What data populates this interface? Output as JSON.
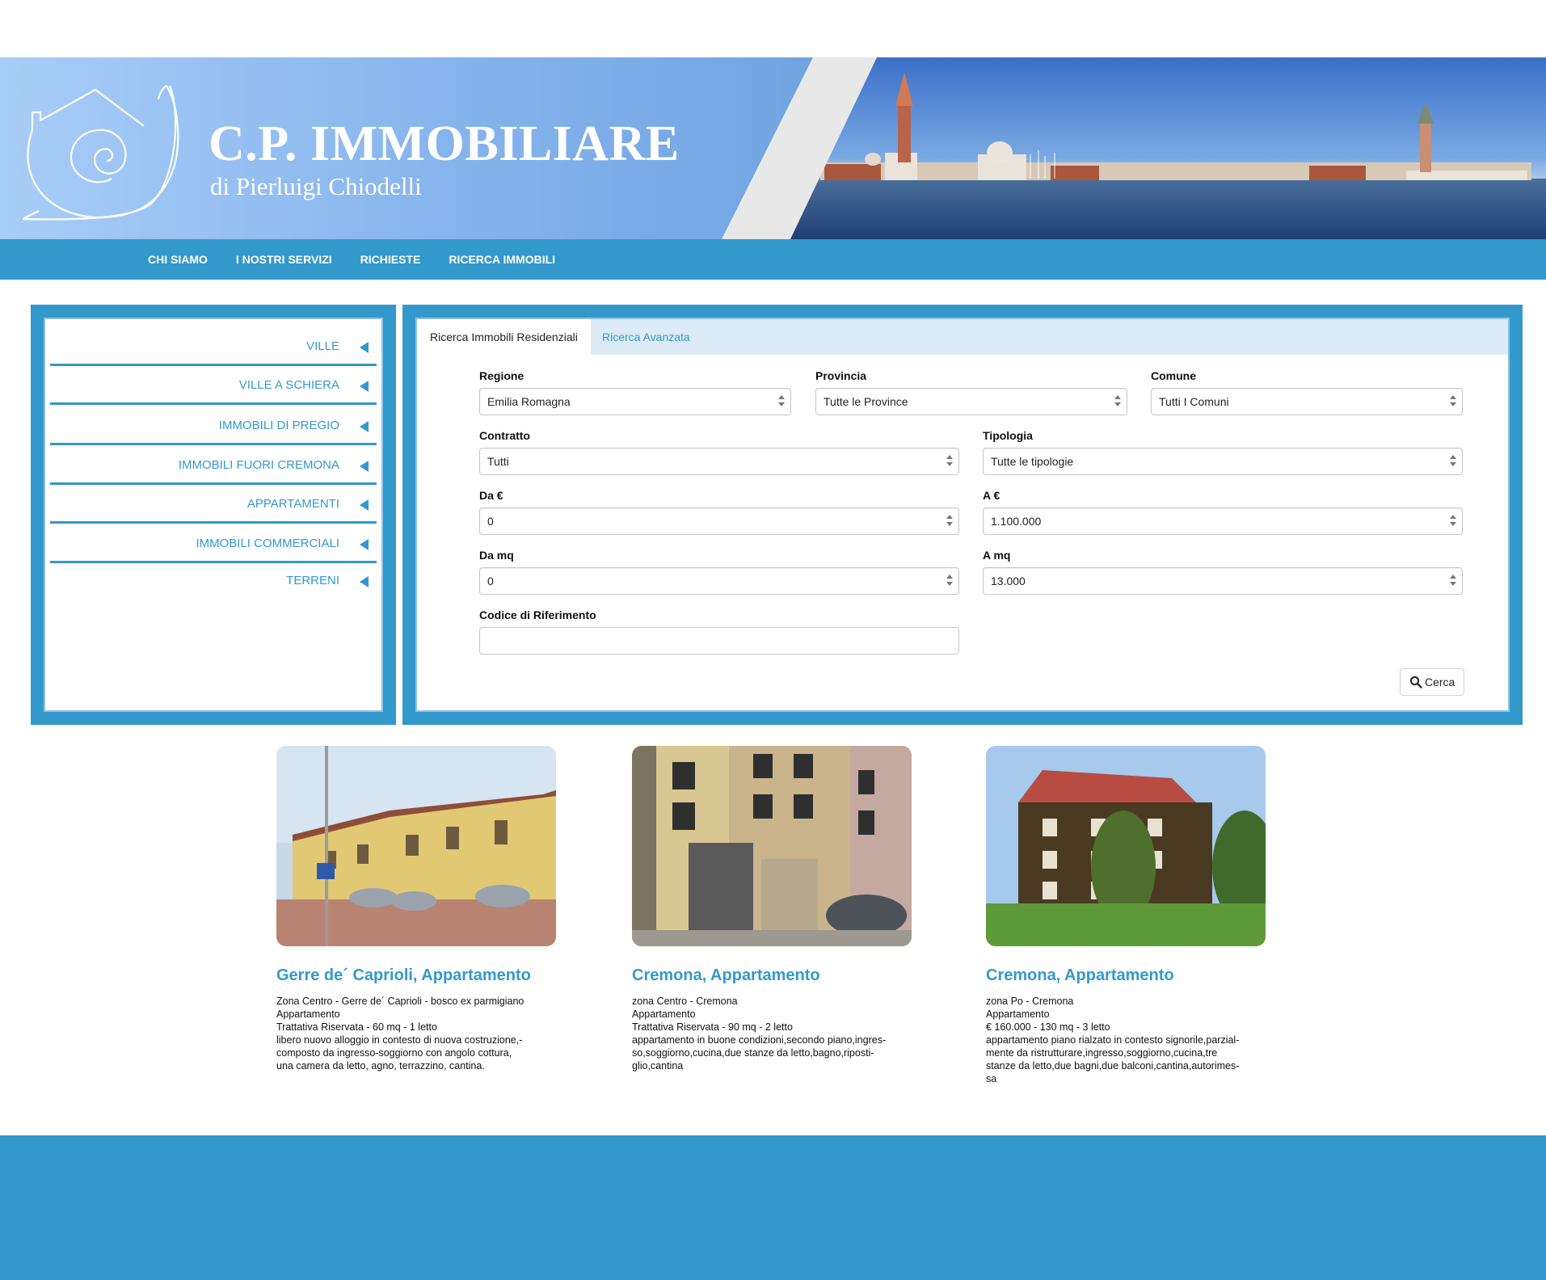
{
  "brand": {
    "title": "C.P. IMMOBILIARE",
    "subtitle": "di Pierluigi Chiodelli"
  },
  "nav": {
    "items": [
      "CHI SIAMO",
      "I NOSTRI SERVIZI",
      "RICHIESTE",
      "RICERCA IMMOBILI"
    ]
  },
  "sidebar": {
    "items": [
      "VILLE",
      "VILLE A SCHIERA",
      "IMMOBILI DI PREGIO",
      "IMMOBILI FUORI CREMONA",
      "APPARTAMENTI",
      "IMMOBILI COMMERCIALI",
      "TERRENI"
    ]
  },
  "search": {
    "tabs": [
      "Ricerca Immobili Residenziali",
      "Ricerca Avanzata"
    ],
    "fields": {
      "regione": {
        "label": "Regione",
        "value": "Emilia Romagna"
      },
      "provincia": {
        "label": "Provincia",
        "value": "Tutte le Province"
      },
      "comune": {
        "label": "Comune",
        "value": "Tutti I Comuni"
      },
      "contratto": {
        "label": "Contratto",
        "value": "Tutti"
      },
      "tipologia": {
        "label": "Tipologia",
        "value": "Tutte le tipologie"
      },
      "da_euro": {
        "label": "Da €",
        "value": "0"
      },
      "a_euro": {
        "label": "A €",
        "value": "1.100.000"
      },
      "da_mq": {
        "label": "Da mq",
        "value": "0"
      },
      "a_mq": {
        "label": "A mq",
        "value": "13.000"
      },
      "codice": {
        "label": "Codice di Riferimento",
        "value": ""
      }
    },
    "submit_label": "Cerca"
  },
  "listings": [
    {
      "title": "Gerre de´ Caprioli, Appartamento",
      "lines": [
        "Zona Centro - Gerre de´ Caprioli - bosco ex parmigiano",
        "Appartamento",
        "Trattativa Riservata - 60 mq - 1 letto",
        "libero nuovo alloggio in contesto di nuova costruzione,-",
        "composto da ingresso-soggiorno con angolo cottura,",
        "una camera da letto, agno, terrazzino, cantina."
      ]
    },
    {
      "title": "Cremona, Appartamento",
      "lines": [
        "zona Centro - Cremona",
        "Appartamento",
        "Trattativa Riservata - 90 mq - 2 letto",
        "appartamento in buone condizioni,secondo piano,ingres-",
        "so,soggiorno,cucina,due stanze da letto,bagno,riposti-",
        "glio,cantina"
      ]
    },
    {
      "title": "Cremona, Appartamento",
      "lines": [
        "zona Po - Cremona",
        "Appartamento",
        "€ 160.000 - 130 mq - 3 letto",
        "appartamento piano rialzato in contesto signorile,parzial-",
        "mente da ristrutturare,ingresso,soggiorno,cucina,tre",
        "stanze da letto,due bagni,due balconi,cantina,autorimes-",
        "sa"
      ]
    }
  ],
  "colors": {
    "accent": "#3399cc",
    "header_light": "#a8cdf7",
    "header_dark": "#5d8fd5",
    "tab_bar": "#dcebf5"
  },
  "icons": [
    "snail-house-logo-icon",
    "triangle-left-icon",
    "search-icon",
    "select-updown-icon"
  ]
}
